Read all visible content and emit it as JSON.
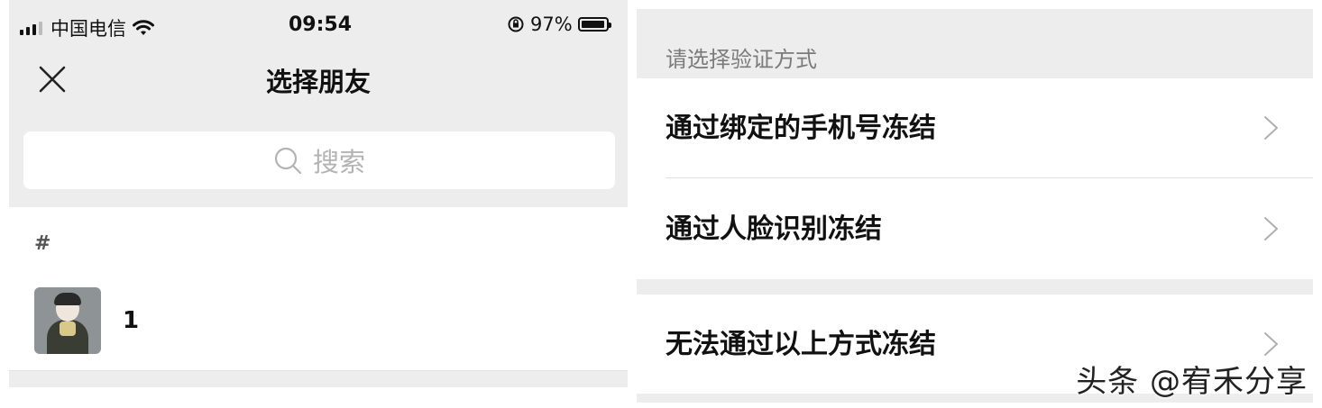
{
  "left": {
    "status": {
      "carrier": "中国电信",
      "time": "09:54",
      "battery_text": "97%",
      "battery_level": 0.97
    },
    "nav": {
      "close_icon": "close-icon",
      "title": "选择朋友"
    },
    "search": {
      "placeholder": "搜索",
      "icon": "search-icon"
    },
    "section": {
      "index_label": "#",
      "contacts": [
        {
          "name": "1",
          "avatar": "avatar-image"
        }
      ]
    }
  },
  "right": {
    "header_label": "请选择验证方式",
    "options": [
      {
        "label": "通过绑定的手机号冻结"
      },
      {
        "label": "通过人脸识别冻结"
      },
      {
        "label": "无法通过以上方式冻结"
      }
    ],
    "watermark": "头条 @宥禾分享"
  }
}
